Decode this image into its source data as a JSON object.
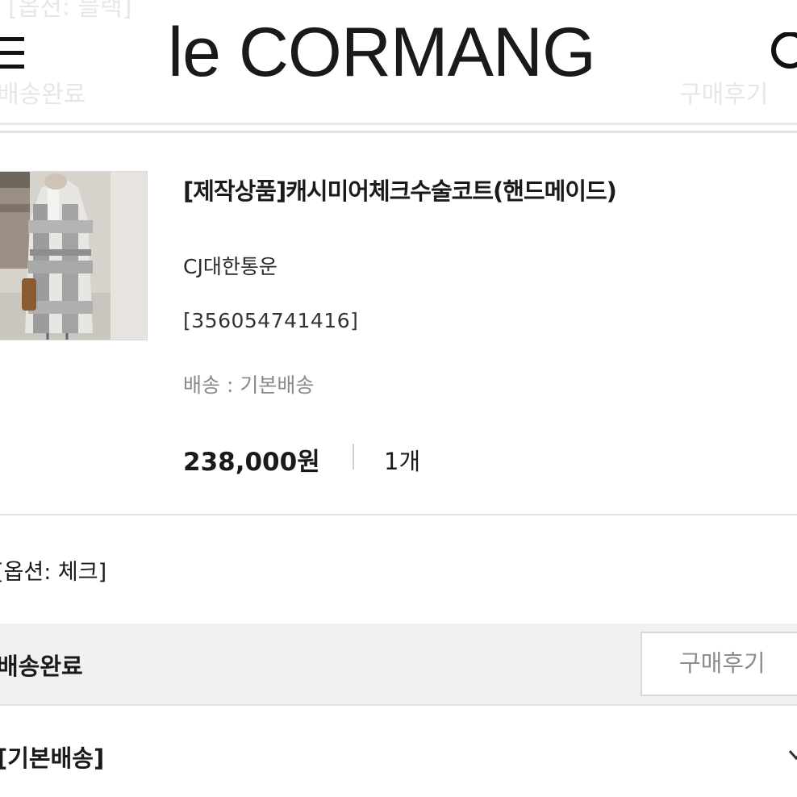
{
  "header": {
    "logo": "le CORMANG",
    "ghost_top": "[옵션: 블랙]",
    "ghost_left": "배송완료",
    "ghost_right": "구매후기"
  },
  "order_item": {
    "product_name": "[제작상품]캐시미어체크수술코트(핸드메이드)",
    "carrier": "CJ대한통운",
    "tracking_number": "[356054741416]",
    "shipping_method": "배송 : 기본배송",
    "price": "238,000원",
    "quantity": "1개",
    "option": "[옵션: 체크]"
  },
  "status": {
    "label": "배송완료",
    "review_button": "구매후기"
  },
  "delivery": {
    "label": "[기본배송]"
  },
  "colors": {
    "status_bar_bg": "#f1f1f1",
    "text_primary": "#1a1a1a",
    "text_muted": "#8a8a8a"
  }
}
